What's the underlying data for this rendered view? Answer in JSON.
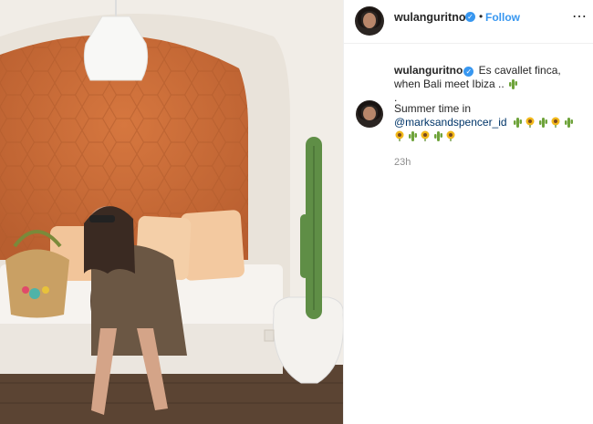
{
  "header": {
    "username": "wulanguritno",
    "verified_mark": "✓",
    "separator": "•",
    "follow_label": "Follow",
    "more_icon": "more-horizontal-icon",
    "more_glyph": "⋯"
  },
  "caption": {
    "username": "wulanguritno",
    "verified_mark": "✓",
    "text_line1": "Es cavallet finca,",
    "text_line2": "when Bali meet Ibiza ..",
    "dot_line": "."
  },
  "comment": {
    "text": "Summer time in",
    "mention": "@marksandspencer_id",
    "emoji_row1": [
      "cactus",
      "sunflower",
      "cactus",
      "sunflower",
      "cactus"
    ],
    "emoji_row2": [
      "sunflower",
      "cactus",
      "sunflower",
      "cactus",
      "sunflower"
    ]
  },
  "timestamp": "23h",
  "colors": {
    "accent": "#3897f0",
    "text": "#262626",
    "muted": "#8e8e8e",
    "wall_orange": "#c86a37"
  }
}
